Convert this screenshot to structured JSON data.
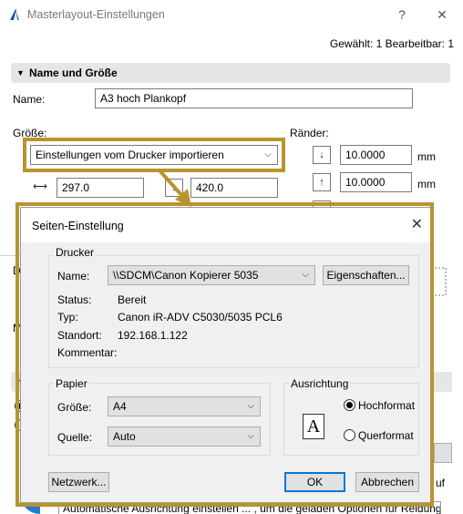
{
  "window": {
    "title": "Masterlayout-Einstellungen",
    "help": "?",
    "close": "✕",
    "selection_info": "Gewählt: 1 Bearbeitbar: 1"
  },
  "name_section": {
    "header": "Name und Größe",
    "name_label": "Name:",
    "name_value": "A3 hoch Plankopf",
    "size_label": "Größe:",
    "size_select": "Einstellungen vom Drucker importieren",
    "width_value": "297.0",
    "height_value": "420.0",
    "margins_label": "Ränder:",
    "margin1": "10.0000",
    "margin2": "10.0000",
    "unit": "mm"
  },
  "background_fragments": {
    "dru": "Dru",
    "mas": "Mas",
    "z_section": "Z",
    "z_radio": "Z",
    "auf": "uf",
    "footer_text": "Automatische Ausrichtung einstellen ... , um die geladen Optionen für Reidung"
  },
  "dialog": {
    "title": "Seiten-Einstellung",
    "printer_group": "Drucker",
    "name_label": "Name:",
    "printer_name": "\\\\SDCM\\Canon Kopierer 5035",
    "properties_button": "Eigenschaften...",
    "status_label": "Status:",
    "status_value": "Bereit",
    "type_label": "Typ:",
    "type_value": "Canon iR-ADV C5030/5035 PCL6",
    "location_label": "Standort:",
    "location_value": "192.168.1.122",
    "comment_label": "Kommentar:",
    "paper_group": "Papier",
    "size_label": "Größe:",
    "size_value": "A4",
    "source_label": "Quelle:",
    "source_value": "Auto",
    "orientation_group": "Ausrichtung",
    "portrait": "Hochformat",
    "landscape": "Querformat",
    "orientation_selected": "Hochformat",
    "page_icon_letter": "A",
    "network_button": "Netzwerk...",
    "ok_button": "OK",
    "cancel_button": "Abbrechen"
  },
  "colors": {
    "callout": "#b8942e",
    "primary_border": "#0078d7"
  }
}
